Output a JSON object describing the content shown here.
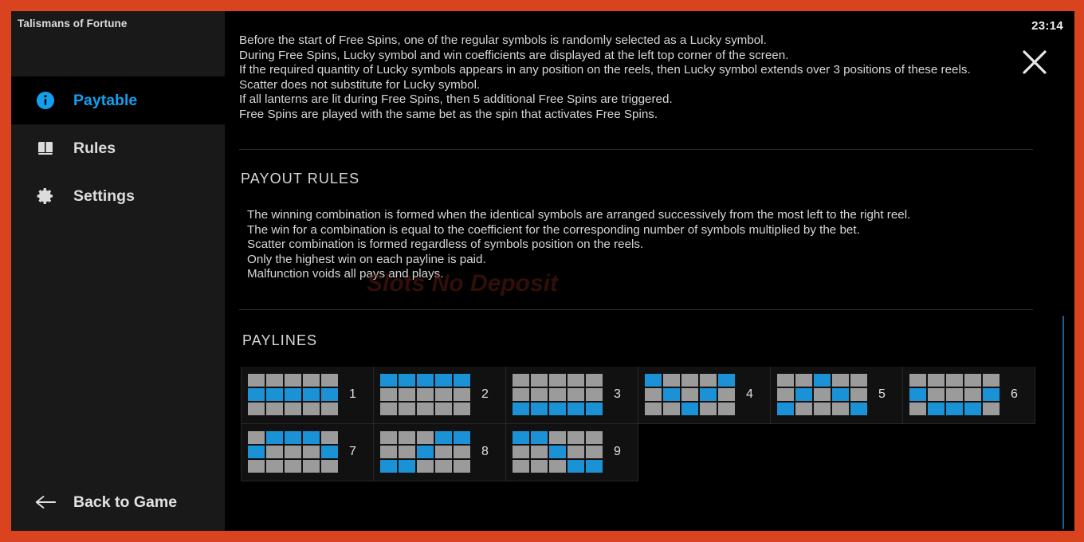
{
  "theme": {
    "frame_color": "#d9431f",
    "background": "#000000",
    "sidebar_background": "#191919",
    "accent": "#12a0ee",
    "reel_on": "#1b91d6",
    "reel_off": "#9b9b9b",
    "text": "#d7d7d7"
  },
  "sidebar": {
    "game_title": "Talismans of Fortune",
    "items": [
      {
        "label": "Paytable",
        "icon": "info-icon",
        "active": true
      },
      {
        "label": "Rules",
        "icon": "book-icon",
        "active": false
      },
      {
        "label": "Settings",
        "icon": "gear-icon",
        "active": false
      }
    ],
    "back_label": "Back to Game",
    "back_icon": "arrow-left-icon"
  },
  "header": {
    "clock": "23:14",
    "close_icon": "close-icon"
  },
  "freespins_text": [
    "Before the start of Free Spins, one of the regular symbols is randomly selected as a Lucky symbol.",
    "During Free Spins, Lucky symbol and win coefficients are displayed at the left top corner of the screen.",
    "If the required quantity of Lucky symbols appears in any position on the reels, then Lucky symbol extends over 3 positions of these reels.",
    "Scatter does not substitute for Lucky symbol.",
    "If all lanterns are lit during Free Spins, then 5 additional Free Spins are triggered.",
    "Free Spins are played with the same bet as the spin that activates Free Spins."
  ],
  "payout_rules": {
    "heading": "PAYOUT RULES",
    "lines": [
      "The winning combination is formed when the identical symbols are arranged successively from the most left to the right reel.",
      "The win for a combination is equal to the coefficient for the corresponding number of symbols multiplied by the bet.",
      "Scatter combination is formed regardless of symbols position on the reels.",
      "Only the highest win on each payline is paid.",
      "Malfunction voids all pays and plays."
    ],
    "watermark": "Slots No Deposit"
  },
  "paylines": {
    "heading": "PAYLINES",
    "reels": 5,
    "rows": 3,
    "items": [
      {
        "number": "1",
        "cells": [
          [
            0,
            0,
            0,
            0,
            0
          ],
          [
            1,
            1,
            1,
            1,
            1
          ],
          [
            0,
            0,
            0,
            0,
            0
          ]
        ]
      },
      {
        "number": "2",
        "cells": [
          [
            1,
            1,
            1,
            1,
            1
          ],
          [
            0,
            0,
            0,
            0,
            0
          ],
          [
            0,
            0,
            0,
            0,
            0
          ]
        ]
      },
      {
        "number": "3",
        "cells": [
          [
            0,
            0,
            0,
            0,
            0
          ],
          [
            0,
            0,
            0,
            0,
            0
          ],
          [
            1,
            1,
            1,
            1,
            1
          ]
        ]
      },
      {
        "number": "4",
        "cells": [
          [
            1,
            0,
            0,
            0,
            1
          ],
          [
            0,
            1,
            0,
            1,
            0
          ],
          [
            0,
            0,
            1,
            0,
            0
          ]
        ]
      },
      {
        "number": "5",
        "cells": [
          [
            0,
            0,
            1,
            0,
            0
          ],
          [
            0,
            1,
            0,
            1,
            0
          ],
          [
            1,
            0,
            0,
            0,
            1
          ]
        ]
      },
      {
        "number": "6",
        "cells": [
          [
            0,
            0,
            0,
            0,
            0
          ],
          [
            1,
            0,
            0,
            0,
            1
          ],
          [
            0,
            1,
            1,
            1,
            0
          ]
        ]
      },
      {
        "number": "7",
        "cells": [
          [
            0,
            1,
            1,
            1,
            0
          ],
          [
            1,
            0,
            0,
            0,
            1
          ],
          [
            0,
            0,
            0,
            0,
            0
          ]
        ]
      },
      {
        "number": "8",
        "cells": [
          [
            0,
            0,
            0,
            1,
            1
          ],
          [
            0,
            0,
            1,
            0,
            0
          ],
          [
            1,
            1,
            0,
            0,
            0
          ]
        ]
      },
      {
        "number": "9",
        "cells": [
          [
            1,
            1,
            0,
            0,
            0
          ],
          [
            0,
            0,
            1,
            0,
            0
          ],
          [
            0,
            0,
            0,
            1,
            1
          ]
        ]
      }
    ]
  }
}
